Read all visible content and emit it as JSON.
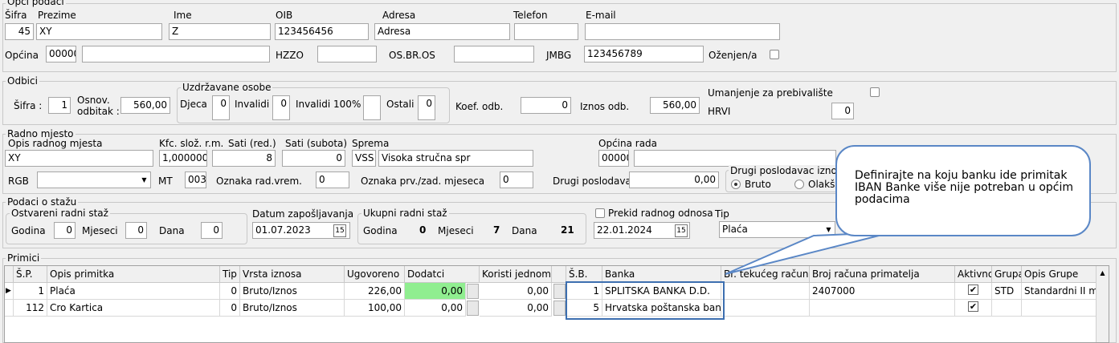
{
  "opci": {
    "legend": "Opći podaci",
    "labels": {
      "sifra": "Šifra",
      "prezime": "Prezime",
      "ime": "Ime",
      "oib": "OIB",
      "adresa": "Adresa",
      "telefon": "Telefon",
      "email": "E-mail",
      "opcina": "Općina",
      "hzzo": "HZZO",
      "osbr": "OS.BR.OS",
      "jmbg": "JMBG",
      "ozenjen": "Oženjen/a"
    },
    "values": {
      "sifra": "45",
      "prezime": "XY",
      "ime": "Z",
      "oib": "123456456",
      "adresa": "Adresa",
      "telefon": "",
      "email": "",
      "opcina_code": "00000",
      "opcina_name": "",
      "hzzo": "",
      "osbr": "",
      "jmbg": "123456789"
    }
  },
  "odbici": {
    "legend": "Odbici",
    "labels": {
      "sifra": "Šifra :",
      "osnov1": "Osnov.",
      "osnov2": "odbitak :",
      "uzdrzavane": "Uzdrž̌avane osobe",
      "djeca": "Djeca",
      "invalidi": "Invalidi",
      "invalidi100": "Invalidi 100%",
      "ostali": "Ostali",
      "koef": "Koef. odb.",
      "iznos": "Iznos odb.",
      "umanjenje": "Umanjenje za prebivalište",
      "hrvi": "HRVI"
    },
    "values": {
      "sifra": "1",
      "osnov": "560,00",
      "djeca": "0",
      "invalidi": "0",
      "invalidi100": "",
      "ostali": "0",
      "koef": "0",
      "iznos": "560,00",
      "hrvi": "0"
    }
  },
  "radno": {
    "legend": "Radno mjesto",
    "labels": {
      "opis": "Opis radnog mjesta",
      "kfc": "Kfc. slož. r.m.",
      "sati_red": "Sati (red.)",
      "sati_sub": "Sati (subota)",
      "sprema": "Sprema",
      "opcina_rada": "Općina rada",
      "rgb": "RGB",
      "mt": "MT",
      "oznaka_rad": "Oznaka rad.vrem.",
      "oznaka_prv": "Oznaka prv./zad. mjeseca",
      "drugi_posl": "Drugi poslodavac",
      "drugi_iznos": "Drugi poslodavac iznos",
      "bruto": "Bruto",
      "olaks": "Olakš"
    },
    "values": {
      "opis": "XY",
      "kfc": "1,000000",
      "sati_red": "8",
      "sati_sub": "0",
      "sprema_code": "VSS",
      "sprema_name": "Visoka stručna spr",
      "opcina_rada_code": "00000",
      "rgb": "",
      "mt": "003",
      "oznaka_rad": "0",
      "oznaka_prv": "0",
      "drugi_posl": "0,00"
    }
  },
  "staz": {
    "legend": "Podaci o stažu",
    "ostvareni_legend": "Ostvareni radni staž",
    "labels": {
      "godina": "Godina",
      "mjeseci": "Mjeseci",
      "dana": "Dana",
      "datum_zap": "Datum zapošljavanja",
      "ukupni": "Ukupni radni staž",
      "prekid": "Prekid radnog odnosa",
      "tip": "Tip"
    },
    "values": {
      "godina": "0",
      "mjeseci": "0",
      "dana": "0",
      "datum_zap": "01.07.2023",
      "uk_godina": "0",
      "uk_mjeseci": "7",
      "uk_dana": "21",
      "prekid_datum": "22.01.2024",
      "tip": "Plaća"
    }
  },
  "primici": {
    "legend": "Primici",
    "columns": [
      "Š.P.",
      "Opis primitka",
      "Tip",
      "Vrsta iznosa",
      "Ugovoreno",
      "Dodatci",
      "Koristi jednom",
      "Š.B.",
      "Banka",
      "Br. tekućeg računa",
      "Broj računa primatelja",
      "Aktivno",
      "Grupa",
      "Opis Grupe"
    ],
    "rows": [
      {
        "sp": "1",
        "opis": "Plaća",
        "tip": "0",
        "vrsta": "Bruto/Iznos",
        "ugovoreno": "226,00",
        "dodatci": "0,00",
        "koristi": "0,00",
        "sb": "1",
        "banka": "SPLITSKA BANKA D.D.",
        "tekuci": "",
        "primatelj": "2407000",
        "aktivno": "✔",
        "grupa": "STD",
        "opis_grupe": "Standardni II m"
      },
      {
        "sp": "112",
        "opis": "Cro Kartica",
        "tip": "0",
        "vrsta": "Bruto/Iznos",
        "ugovoreno": "100,00",
        "dodatci": "0,00",
        "koristi": "0,00",
        "sb": "5",
        "banka": "Hrvatska poštanska bank",
        "tekuci": "",
        "primatelj": "",
        "aktivno": "✔",
        "grupa": "",
        "opis_grupe": ""
      }
    ]
  },
  "callout": {
    "text": "Definirajte na koju banku ide primitak IBAN Banke više nije potreban u općim podacima"
  },
  "colors": {
    "highlight_green": "#90ee90",
    "callout_border": "#5a87c6"
  }
}
